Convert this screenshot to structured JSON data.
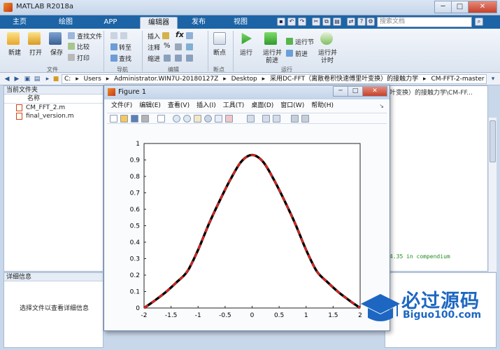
{
  "window": {
    "title": "MATLAB R2018a"
  },
  "tabs": [
    {
      "label": "主页",
      "active": false
    },
    {
      "label": "绘图",
      "active": false
    },
    {
      "label": "APP",
      "active": false
    },
    {
      "label": "编辑器",
      "active": true
    },
    {
      "label": "发布",
      "active": false
    },
    {
      "label": "视图",
      "active": false
    }
  ],
  "search": {
    "placeholder": "搜索文档"
  },
  "ribbon": {
    "file": {
      "new": "新建",
      "open": "打开",
      "save": "保存",
      "find_files": "查找文件",
      "compare": "比较",
      "print": "打印",
      "group": "文件"
    },
    "navigate": {
      "goto": "转至",
      "find": "查找",
      "group": "导航"
    },
    "edit": {
      "insert": "插入",
      "comment": "注释",
      "indent": "缩进",
      "group": "编辑"
    },
    "breakpoints": {
      "label": "断点",
      "group": "断点"
    },
    "run": {
      "run": "运行",
      "run_advance_1": "运行并",
      "run_advance_2": "前进",
      "run_section": "运行节",
      "advance": "前进",
      "run_time_1": "运行并",
      "run_time_2": "计时",
      "group": "运行"
    }
  },
  "address": {
    "segments": [
      "C:",
      "▸",
      "Users",
      "▸",
      "Administrator.WIN7U-20180127Z",
      "▸",
      "Desktop",
      "▸",
      "采用DC-FFT（离散卷积快速傅里叶变换）的接触力学",
      "▸",
      "CM-FFT-2-master"
    ]
  },
  "current_folder": {
    "title": "当前文件夹",
    "column_name": "名称",
    "files": [
      "CM_FFT_2.m",
      "final_version.m"
    ]
  },
  "details": {
    "title": "详细信息",
    "message": "选择文件以查看详细信息"
  },
  "right_panel": {
    "title_fragment": "叶变换）的接触力学\\CM-FF...",
    "code_text": "4.35 in compendium"
  },
  "figure": {
    "title": "Figure 1",
    "menu": [
      "文件(F)",
      "编辑(E)",
      "查看(V)",
      "插入(I)",
      "工具(T)",
      "桌面(D)",
      "窗口(W)",
      "帮助(H)"
    ]
  },
  "chart_data": {
    "type": "line",
    "title": "",
    "xlabel": "",
    "ylabel": "",
    "xlim": [
      -2,
      2
    ],
    "ylim": [
      0,
      1
    ],
    "xticks": [
      "-2",
      "-1.5",
      "-1",
      "-0.5",
      "0",
      "0.5",
      "1",
      "1.5",
      "2"
    ],
    "yticks": [
      "0",
      "0.1",
      "0.2",
      "0.3",
      "0.4",
      "0.5",
      "0.6",
      "0.7",
      "0.8",
      "0.9",
      "1"
    ],
    "grid": false,
    "x": [
      -2,
      -1.8,
      -1.6,
      -1.4,
      -1.2,
      -1.0,
      -0.8,
      -0.6,
      -0.4,
      -0.2,
      0,
      0.2,
      0.4,
      0.6,
      0.8,
      1.0,
      1.2,
      1.4,
      1.6,
      1.8,
      2.0
    ],
    "series": [
      {
        "style": "solid",
        "color": "#000000",
        "values": [
          0.0,
          0.046,
          0.096,
          0.156,
          0.222,
          0.353,
          0.511,
          0.652,
          0.782,
          0.89,
          0.93,
          0.89,
          0.782,
          0.652,
          0.511,
          0.353,
          0.222,
          0.156,
          0.096,
          0.046,
          0.0
        ]
      },
      {
        "style": "dashed",
        "color": "#e8231e",
        "values": [
          0.0,
          0.046,
          0.096,
          0.156,
          0.222,
          0.353,
          0.511,
          0.652,
          0.782,
          0.89,
          0.93,
          0.89,
          0.782,
          0.652,
          0.511,
          0.353,
          0.222,
          0.156,
          0.096,
          0.046,
          0.0
        ]
      }
    ]
  },
  "watermark": {
    "title": "必过源码",
    "url": "Biguo100.com"
  },
  "colors": {
    "ribbon_tab_bg": "#1c64a6",
    "accent": "#1d67c2"
  }
}
